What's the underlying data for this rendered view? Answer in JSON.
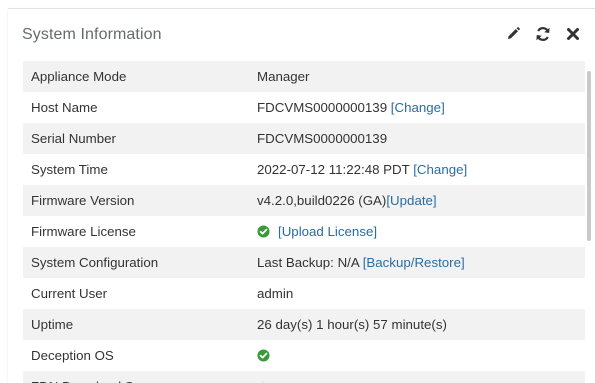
{
  "widget": {
    "title": "System Information",
    "header_icons": [
      "pencil-icon",
      "refresh-icon",
      "close-icon"
    ]
  },
  "rows": [
    {
      "label": "Appliance Mode",
      "value": "Manager"
    },
    {
      "label": "Host Name",
      "value": "FDCVMS0000000139",
      "link": "[Change]"
    },
    {
      "label": "Serial Number",
      "value": "FDCVMS0000000139"
    },
    {
      "label": "System Time",
      "value": "2022-07-12 11:22:48 PDT",
      "link": "[Change]"
    },
    {
      "label": "Firmware Version",
      "value": "v4.2.0,build0226 (GA)",
      "link": "[Update]"
    },
    {
      "label": "Firmware License",
      "icon": "check-circle-icon",
      "link": "[Upload License]"
    },
    {
      "label": "System Configuration",
      "value": "Last Backup: N/A",
      "link": "[Backup/Restore]"
    },
    {
      "label": "Current User",
      "value": "admin"
    },
    {
      "label": "Uptime",
      "value": "26 day(s) 1 hour(s) 57 minute(s)"
    },
    {
      "label": "Deception OS",
      "icon": "check-circle-icon"
    },
    {
      "label": "FDN Download S",
      "icon": "warning-icon"
    }
  ],
  "colors": {
    "link": "#2b6ca3",
    "ok_green": "#3a9a3a",
    "warning_orange": "#f0a020",
    "row_stripe": "#f2f2f2",
    "title_gray": "#666a70"
  }
}
